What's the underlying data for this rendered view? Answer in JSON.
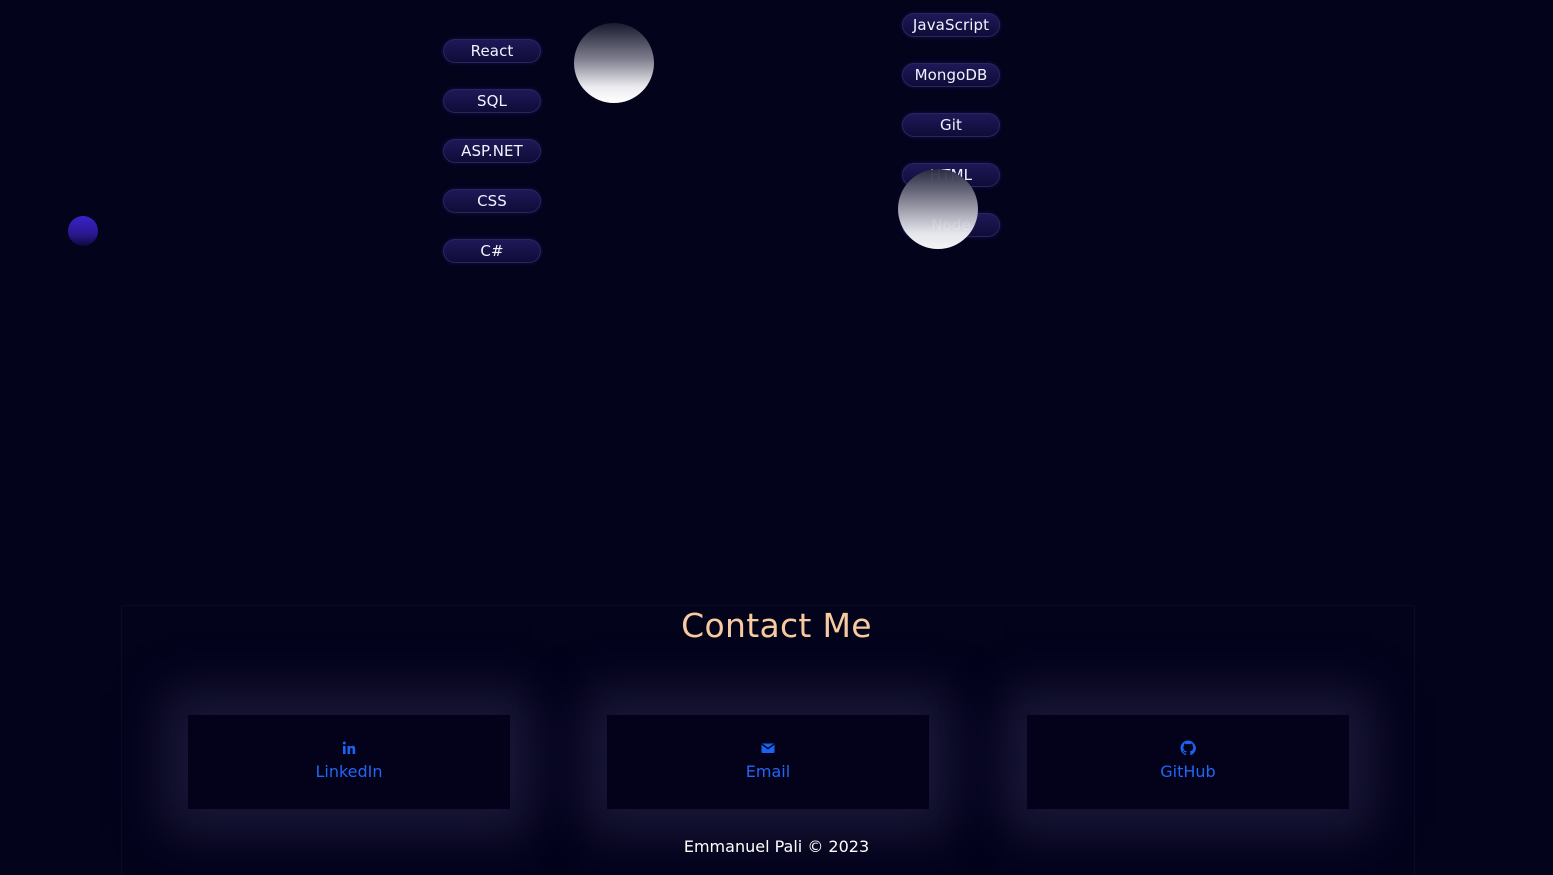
{
  "skills": {
    "left": [
      "React",
      "SQL",
      "ASP.NET",
      "CSS",
      "C#"
    ],
    "right": [
      "JavaScript",
      "MongoDB",
      "Git",
      "HTML",
      "Node"
    ]
  },
  "contact": {
    "title": "Contact Me",
    "links": [
      {
        "label": "LinkedIn",
        "icon": "linkedin-icon"
      },
      {
        "label": "Email",
        "icon": "mail-icon"
      },
      {
        "label": "GitHub",
        "icon": "github-icon"
      }
    ]
  },
  "footer": {
    "copyright": "Emmanuel Pali © 2023"
  },
  "colors": {
    "background": "#04031c",
    "title": "#f7caa1",
    "link": "#2266f2"
  }
}
